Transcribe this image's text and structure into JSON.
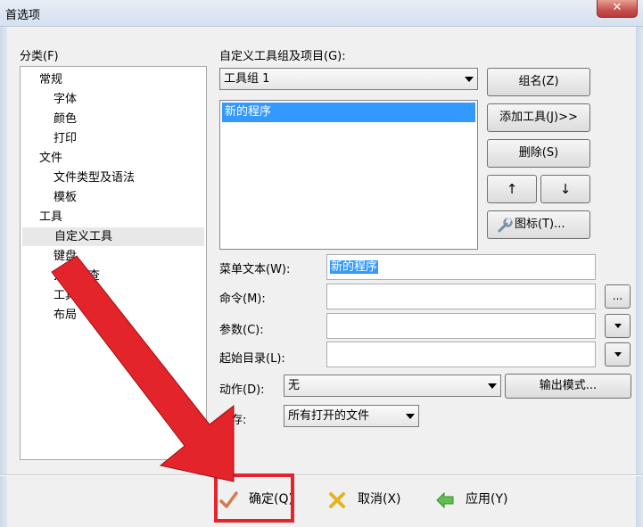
{
  "window": {
    "title": "首选项",
    "close_label": "✕"
  },
  "category": {
    "label": "分类(F)",
    "items": [
      {
        "label": "常规"
      },
      {
        "label": "字体"
      },
      {
        "label": "颜色"
      },
      {
        "label": "打印"
      },
      {
        "label": "文件"
      },
      {
        "label": "文件类型及语法"
      },
      {
        "label": "模板"
      },
      {
        "label": "工具"
      },
      {
        "label": "自定义工具"
      },
      {
        "label": "键盘"
      },
      {
        "label": "拼写检查"
      },
      {
        "label": "工具栏"
      },
      {
        "label": "布局"
      }
    ]
  },
  "tools": {
    "group_label": "自定义工具组及项目(G):",
    "group_value": "工具组 1",
    "list_items": [
      "新的程序"
    ],
    "buttons": {
      "group": "组名(Z)",
      "add": "添加工具(J)>>",
      "delete": "删除(S)",
      "up": "↑",
      "down": "↓",
      "icon": "图标(T)..."
    }
  },
  "form": {
    "menu_text_label": "菜单文本(W):",
    "menu_text_value": "新的程序",
    "command_label": "命令(M):",
    "command_value": "",
    "browse_label": "...",
    "params_label": "参数(C):",
    "params_value": "",
    "startdir_label": "起始目录(L):",
    "startdir_value": "",
    "action_label": "动作(D):",
    "action_value": "无",
    "output_mode": "输出模式...",
    "save_label": "保存:",
    "save_value": "所有打开的文件"
  },
  "footer": {
    "ok": "确定(Q)",
    "cancel": "取消(X)",
    "apply": "应用(Y)"
  },
  "colors": {
    "selection": "#3399ff",
    "annotation_red": "#e4242b",
    "ok_icon": "#d47a4f",
    "cancel_icon": "#e6b422",
    "apply_icon": "#4caf50"
  },
  "icons": {
    "ok": "checkmark-icon",
    "cancel": "cross-icon",
    "apply": "green-arrow-icon",
    "tool": "wrench-icon"
  }
}
